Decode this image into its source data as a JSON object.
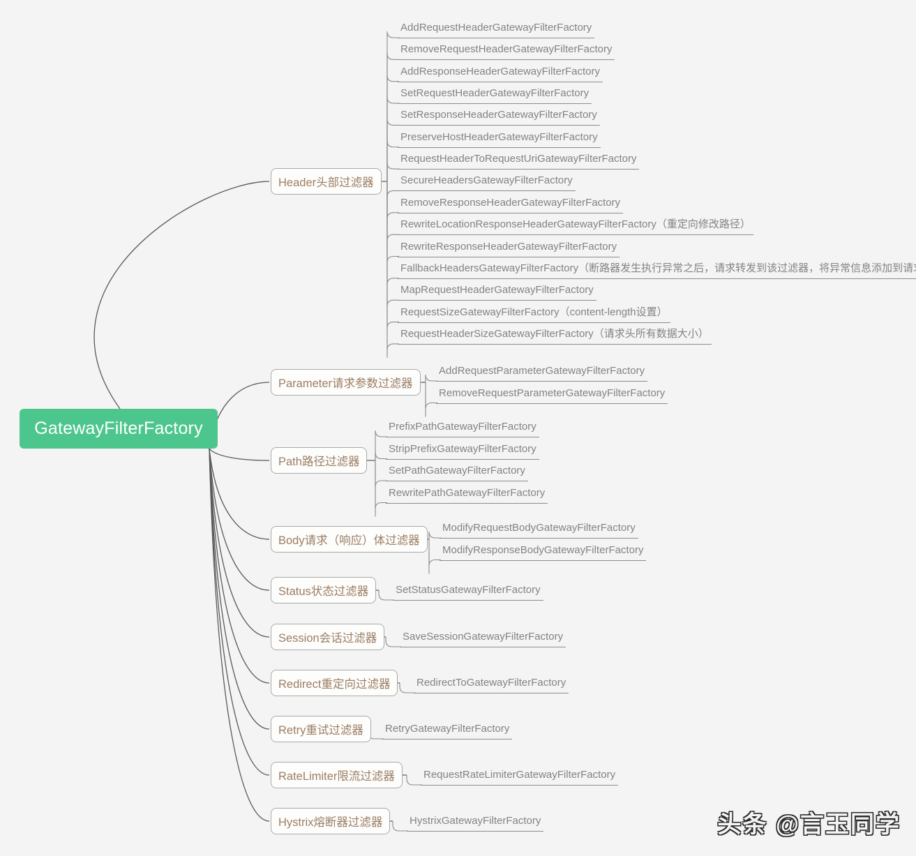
{
  "diagram": {
    "type": "mindmap",
    "background_color": "#f4f4f4",
    "root": {
      "label": "GatewayFilterFactory",
      "fill_color": "#4dc68e",
      "text_color": "#ffffff"
    },
    "branch_style": {
      "text_color": "#9c7e63",
      "border_color": "#a9a9a9",
      "fill_color": "#fdfdfc"
    },
    "leaf_style": {
      "text_color": "#838383",
      "underline_color": "#8c8c8c"
    },
    "branches": [
      {
        "label": "Header头部过滤器",
        "leaves": [
          "AddRequestHeaderGatewayFilterFactory",
          "RemoveRequestHeaderGatewayFilterFactory",
          "AddResponseHeaderGatewayFilterFactory",
          "SetRequestHeaderGatewayFilterFactory",
          "SetResponseHeaderGatewayFilterFactory",
          "PreserveHostHeaderGatewayFilterFactory",
          "RequestHeaderToRequestUriGatewayFilterFactory",
          "SecureHeadersGatewayFilterFactory",
          "RemoveResponseHeaderGatewayFilterFactory",
          "RewriteLocationResponseHeaderGatewayFilterFactory（重定向修改路径）",
          "RewriteResponseHeaderGatewayFilterFactory",
          "FallbackHeadersGatewayFilterFactory（断路器发生执行异常之后，请求转发到该过滤器，将异常信息添加到请求头中）",
          "MapRequestHeaderGatewayFilterFactory",
          "RequestSizeGatewayFilterFactory（content-length设置）",
          "RequestHeaderSizeGatewayFilterFactory（请求头所有数据大小）"
        ]
      },
      {
        "label": "Parameter请求参数过滤器",
        "leaves": [
          "AddRequestParameterGatewayFilterFactory",
          "RemoveRequestParameterGatewayFilterFactory"
        ]
      },
      {
        "label": "Path路径过滤器",
        "leaves": [
          "PrefixPathGatewayFilterFactory",
          "StripPrefixGatewayFilterFactory",
          "SetPathGatewayFilterFactory",
          "RewritePathGatewayFilterFactory"
        ]
      },
      {
        "label": "Body请求（响应）体过滤器",
        "leaves": [
          "ModifyRequestBodyGatewayFilterFactory",
          "ModifyResponseBodyGatewayFilterFactory"
        ]
      },
      {
        "label": "Status状态过滤器",
        "leaves": [
          "SetStatusGatewayFilterFactory"
        ]
      },
      {
        "label": "Session会话过滤器",
        "leaves": [
          "SaveSessionGatewayFilterFactory"
        ]
      },
      {
        "label": "Redirect重定向过滤器",
        "leaves": [
          "RedirectToGatewayFilterFactory"
        ]
      },
      {
        "label": "Retry重试过滤器",
        "leaves": [
          "RetryGatewayFilterFactory"
        ]
      },
      {
        "label": "RateLimiter限流过滤器",
        "leaves": [
          "RequestRateLimiterGatewayFilterFactory"
        ]
      },
      {
        "label": "Hystrix熔断器过滤器",
        "leaves": [
          "HystrixGatewayFilterFactory"
        ]
      }
    ]
  },
  "watermark": {
    "text": "头条 @言玉同学"
  }
}
